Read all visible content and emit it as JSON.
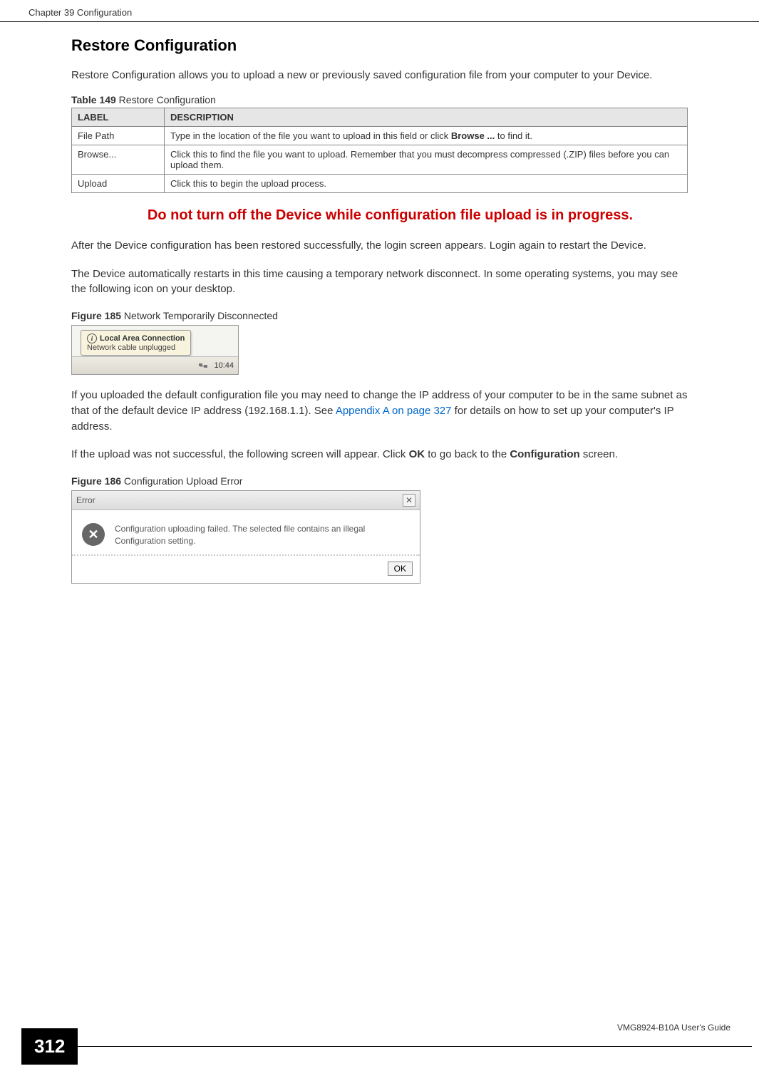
{
  "header": {
    "chapter": "Chapter 39 Configuration"
  },
  "section_heading": "Restore Configuration",
  "intro": "Restore Configuration allows you to upload a new or previously saved configuration file from your computer to your Device.",
  "table_caption_prefix": "Table 149",
  "table_caption_suffix": "   Restore Configuration",
  "table": {
    "col_label": "LABEL",
    "col_desc": "DESCRIPTION",
    "rows": [
      {
        "label": "File Path",
        "desc_pre": "Type in the location of the file you want to upload in this field or click ",
        "desc_bold": "Browse ...",
        "desc_post": " to find it."
      },
      {
        "label": "Browse...",
        "desc_pre": "Click this to find the file you want to upload. Remember that you must decompress compressed (.ZIP) files before you can upload them.",
        "desc_bold": "",
        "desc_post": ""
      },
      {
        "label": "Upload",
        "desc_pre": "Click this to begin the upload process.",
        "desc_bold": "",
        "desc_post": ""
      }
    ]
  },
  "warning": "Do not turn off the Device while configuration file upload is in progress.",
  "para_after_warning": "After the Device configuration has been restored successfully, the login screen appears. Login again to restart the Device.",
  "para_auto_restart": "The Device automatically restarts in this time causing a temporary network disconnect. In some operating systems, you may see the following icon on your desktop.",
  "fig185_prefix": "Figure 185",
  "fig185_suffix": "   Network Temporarily Disconnected",
  "tooltip": {
    "title": "Local Area Connection",
    "sub": "Network cable unplugged",
    "time": "10:44"
  },
  "para_ip_pre": "If you uploaded the default configuration file you may need to change the IP address of your computer to be in the same subnet as that of the default device IP address (",
  "para_ip_addr": "192.168.1.1",
  "para_ip_mid": "). See ",
  "para_ip_link": "Appendix A on page 327",
  "para_ip_post": " for details on how to set up your computer's IP address.",
  "para_fail_pre": "If the upload was not successful, the following screen will appear. Click ",
  "para_fail_ok": "OK",
  "para_fail_mid": " to go back to the ",
  "para_fail_config": "Configuration",
  "para_fail_post": " screen.",
  "fig186_prefix": "Figure 186",
  "fig186_suffix": "   Configuration Upload Error",
  "error_dialog": {
    "title": "Error",
    "close": "✕",
    "icon": "✕",
    "msg": "Configuration uploading failed. The selected file contains an illegal Configuration setting.",
    "ok": "OK"
  },
  "footer": {
    "page": "312",
    "guide": "VMG8924-B10A User's Guide"
  }
}
